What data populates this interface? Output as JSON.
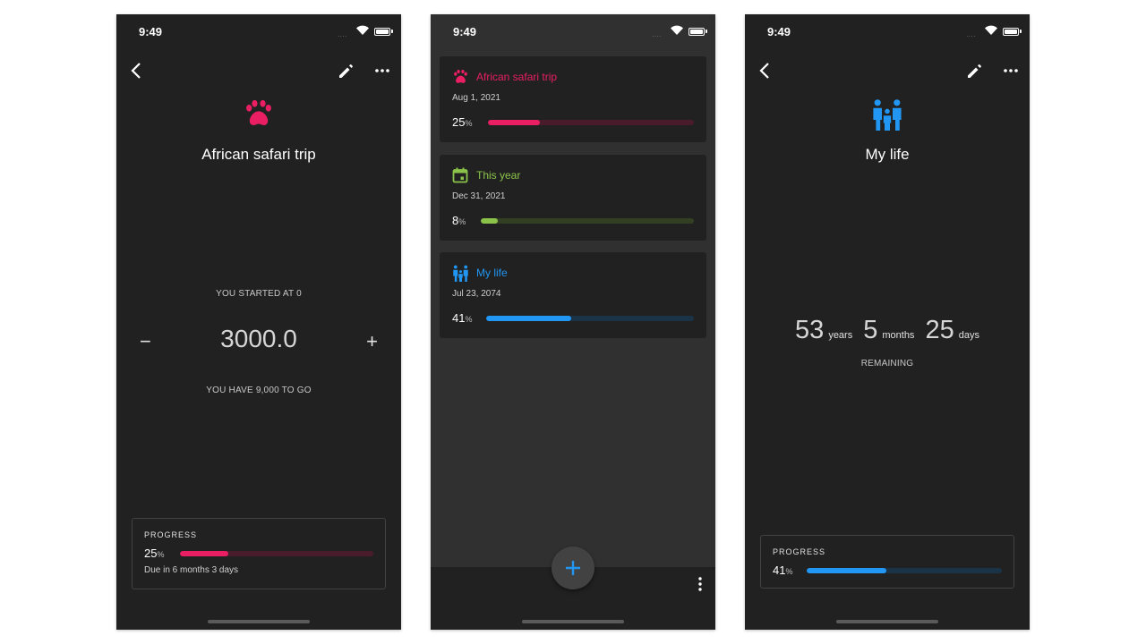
{
  "colors": {
    "pink": "#e91e63",
    "pink_track": "#4a1c2b",
    "green": "#8bc34a",
    "green_track": "#333f22",
    "blue": "#2196f3",
    "blue_track": "#1b3347"
  },
  "status_bar": {
    "time": "9:49"
  },
  "safari_screen": {
    "title": "African safari trip",
    "icon": "paw-icon",
    "started_caption": "YOU STARTED AT 0",
    "counter_value": "3000.0",
    "minus_label": "−",
    "plus_label": "+",
    "to_go_caption": "YOU HAVE 9,000 TO GO",
    "progress": {
      "label": "PROGRESS",
      "percent": 25,
      "percent_text": "25",
      "percent_sign": "%",
      "due": "Due in 6 months 3 days"
    }
  },
  "list_screen": {
    "cards": [
      {
        "title": "African safari trip",
        "date": "Aug 1, 2021",
        "percent": 25,
        "percent_text": "25",
        "percent_sign": "%",
        "icon": "paw-icon"
      },
      {
        "title": "This year",
        "date": "Dec 31, 2021",
        "percent": 8,
        "percent_text": "8",
        "percent_sign": "%",
        "icon": "calendar-icon"
      },
      {
        "title": "My life",
        "date": "Jul 23, 2074",
        "percent": 41,
        "percent_text": "41",
        "percent_sign": "%",
        "icon": "family-icon"
      }
    ],
    "fab_icon": "plus-icon",
    "menu_icon": "more-vertical-icon"
  },
  "life_screen": {
    "title": "My life",
    "icon": "family-icon",
    "remaining": {
      "years": "53",
      "years_unit": "years",
      "months": "5",
      "months_unit": "months",
      "days": "25",
      "days_unit": "days",
      "caption": "REMAINING"
    },
    "progress": {
      "label": "PROGRESS",
      "percent": 41,
      "percent_text": "41",
      "percent_sign": "%"
    }
  }
}
